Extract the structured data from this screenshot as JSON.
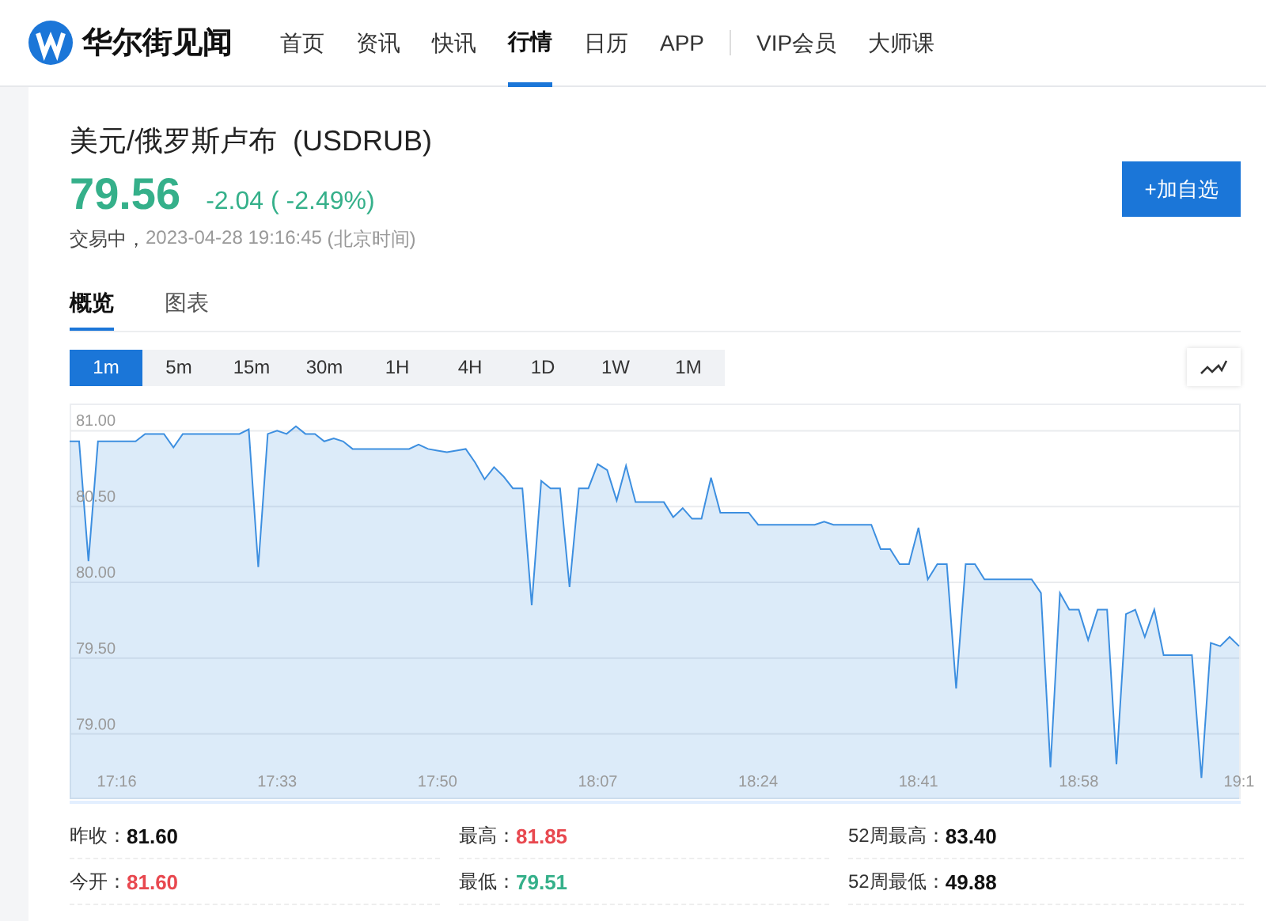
{
  "nav": {
    "logo": "华尔街见闻",
    "items": [
      {
        "label": "首页",
        "selected": false
      },
      {
        "label": "资讯",
        "selected": false
      },
      {
        "label": "快讯",
        "selected": false
      },
      {
        "label": "行情",
        "selected": true
      },
      {
        "label": "日历",
        "selected": false
      },
      {
        "label": "APP",
        "selected": false,
        "divider_after": true
      },
      {
        "label": "VIP会员",
        "selected": false
      },
      {
        "label": "大师课",
        "selected": false
      }
    ]
  },
  "quote": {
    "title": "美元/俄罗斯卢布  (USDRUB)",
    "price": "79.56",
    "change": "-2.04 ( -2.49%)",
    "color": "#35b08a",
    "status": "交易中，",
    "time": "2023-04-28 19:16:45",
    "timezone": "(北京时间)",
    "button": "+加自选"
  },
  "tabs": [
    {
      "label": "概览",
      "selected": true
    },
    {
      "label": "图表",
      "selected": false
    }
  ],
  "periods": [
    {
      "label": "1m",
      "selected": true
    },
    {
      "label": "5m",
      "selected": false
    },
    {
      "label": "15m",
      "selected": false
    },
    {
      "label": "30m",
      "selected": false
    },
    {
      "label": "1H",
      "selected": false
    },
    {
      "label": "4H",
      "selected": false
    },
    {
      "label": "1D",
      "selected": false
    },
    {
      "label": "1W",
      "selected": false
    },
    {
      "label": "1M",
      "selected": false
    }
  ],
  "chart_data": {
    "type": "area",
    "grid": true,
    "ylim": [
      78.57,
      81.18
    ],
    "yticks": [
      {
        "value": 79,
        "label": "79.00"
      },
      {
        "value": 79.5,
        "label": "79.50"
      },
      {
        "value": 80,
        "label": "80.00"
      },
      {
        "value": 80.5,
        "label": "80.50"
      },
      {
        "value": 81,
        "label": "81.00"
      }
    ],
    "categories": [
      null,
      null,
      null,
      null,
      null,
      "17:16",
      null,
      null,
      null,
      null,
      null,
      null,
      null,
      null,
      null,
      null,
      null,
      null,
      null,
      null,
      null,
      null,
      "17:33",
      null,
      null,
      null,
      null,
      null,
      null,
      null,
      null,
      null,
      null,
      null,
      null,
      null,
      null,
      null,
      null,
      "17:50",
      null,
      null,
      null,
      null,
      null,
      null,
      null,
      null,
      null,
      null,
      null,
      null,
      null,
      null,
      null,
      null,
      "18:07",
      null,
      null,
      null,
      null,
      null,
      null,
      null,
      null,
      null,
      null,
      null,
      null,
      null,
      null,
      null,
      null,
      "18:24",
      null,
      null,
      null,
      null,
      null,
      null,
      null,
      null,
      null,
      null,
      null,
      null,
      null,
      null,
      null,
      null,
      "18:41",
      null,
      null,
      null,
      null,
      null,
      null,
      null,
      null,
      null,
      null,
      null,
      null,
      null,
      null,
      null,
      null,
      "18:58",
      null,
      null,
      null,
      null,
      null,
      null,
      null,
      null,
      null,
      null,
      null,
      null,
      null,
      null,
      null,
      null,
      "19:1"
    ],
    "series": [
      {
        "color": "#3d8fe0",
        "values": [
          80.93,
          80.93,
          80.14,
          80.93,
          80.93,
          80.93,
          80.93,
          80.93,
          80.98,
          80.98,
          80.98,
          80.89,
          80.98,
          80.98,
          80.98,
          80.98,
          80.98,
          80.98,
          80.98,
          81.01,
          80.1,
          80.98,
          81.0,
          80.98,
          81.03,
          80.98,
          80.98,
          80.93,
          80.95,
          80.93,
          80.88,
          80.88,
          80.88,
          80.88,
          80.88,
          80.88,
          80.88,
          80.91,
          80.88,
          80.87,
          80.86,
          80.87,
          80.88,
          80.79,
          80.68,
          80.76,
          80.7,
          80.62,
          80.62,
          79.85,
          80.67,
          80.62,
          80.62,
          79.97,
          80.62,
          80.62,
          80.78,
          80.74,
          80.54,
          80.77,
          80.53,
          80.53,
          80.53,
          80.53,
          80.43,
          80.49,
          80.42,
          80.42,
          80.69,
          80.46,
          80.46,
          80.46,
          80.46,
          80.38,
          80.38,
          80.38,
          80.38,
          80.38,
          80.38,
          80.38,
          80.4,
          80.38,
          80.38,
          80.38,
          80.38,
          80.38,
          80.22,
          80.22,
          80.12,
          80.12,
          80.36,
          80.02,
          80.12,
          80.12,
          79.3,
          80.12,
          80.12,
          80.02,
          80.02,
          80.02,
          80.02,
          80.02,
          80.02,
          79.93,
          78.78,
          79.93,
          79.82,
          79.82,
          79.62,
          79.82,
          79.82,
          78.8,
          79.79,
          79.82,
          79.64,
          79.82,
          79.52,
          79.52,
          79.52,
          79.52,
          78.71,
          79.6,
          79.58,
          79.64,
          79.58
        ]
      }
    ]
  },
  "stats": [
    {
      "label": "昨收：",
      "value": "81.60",
      "color": "#111111"
    },
    {
      "label": "最高：",
      "value": "81.85",
      "color": "#e8484f"
    },
    {
      "label": "52周最高：",
      "value": "83.40",
      "color": "#111111"
    },
    {
      "label": "今开：",
      "value": "81.60",
      "color": "#e8484f"
    },
    {
      "label": "最低：",
      "value": "79.51",
      "color": "#35b08a"
    },
    {
      "label": "52周最低：",
      "value": "49.88",
      "color": "#111111"
    }
  ]
}
